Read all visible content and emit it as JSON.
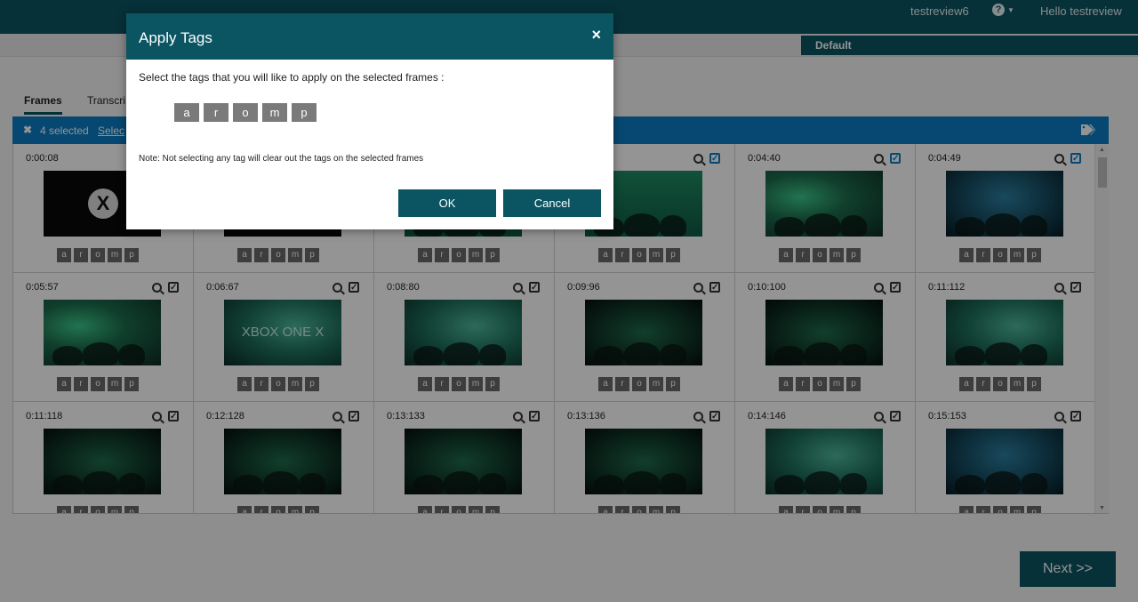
{
  "topbar": {
    "account": "testreview6",
    "help": "?",
    "greeting": "Hello testreview"
  },
  "project_tab": "Default",
  "tabs": [
    "Frames",
    "Transcri"
  ],
  "selection_bar": {
    "count": "4 selected",
    "select_link": "Selec"
  },
  "frame_tags": [
    "a",
    "r",
    "o",
    "m",
    "p"
  ],
  "frames": [
    {
      "time": "0:00:08",
      "thumb": "xbox-logo",
      "checked": false
    },
    {
      "time": "",
      "thumb": "dark",
      "checked": false
    },
    {
      "time": "",
      "thumb": "stage",
      "checked": false
    },
    {
      "time": "",
      "thumb": "stage",
      "checked": true
    },
    {
      "time": "0:04:40",
      "thumb": "crowd",
      "checked": true
    },
    {
      "time": "0:04:49",
      "thumb": "blue",
      "checked": true
    },
    {
      "time": "0:05:57",
      "thumb": "crowd",
      "checked": false
    },
    {
      "time": "0:06:67",
      "thumb": "xbox-one-x",
      "checked": false
    },
    {
      "time": "0:08:80",
      "thumb": "teal",
      "checked": false
    },
    {
      "time": "0:09:96",
      "thumb": "night",
      "checked": false
    },
    {
      "time": "0:10:100",
      "thumb": "night",
      "checked": false
    },
    {
      "time": "0:11:112",
      "thumb": "teal",
      "checked": false
    },
    {
      "time": "0:11:118",
      "thumb": "night",
      "checked": false
    },
    {
      "time": "0:12:128",
      "thumb": "night",
      "checked": false
    },
    {
      "time": "0:13:133",
      "thumb": "night",
      "checked": false
    },
    {
      "time": "0:13:136",
      "thumb": "night",
      "checked": false
    },
    {
      "time": "0:14:146",
      "thumb": "teal",
      "checked": false
    },
    {
      "time": "0:15:153",
      "thumb": "blue",
      "checked": false
    }
  ],
  "thumb_text": {
    "xbox_one_x": "XBOX ONE X",
    "xbox_logo": "X"
  },
  "next_button": "Next >>",
  "modal": {
    "title": "Apply Tags",
    "close": "×",
    "prompt": "Select the tags that you will like to apply on the selected frames :",
    "tags": [
      "a",
      "r",
      "o",
      "m",
      "p"
    ],
    "note": "Note: Not selecting any tag will clear out the tags on the selected frames",
    "ok": "OK",
    "cancel": "Cancel"
  },
  "colors": {
    "header": "#0b5563",
    "selection_bar": "#0b7cc3",
    "tag_bg": "#6a6a6a"
  },
  "icons": [
    "help-icon",
    "close-icon",
    "tag-icon",
    "zoom-icon",
    "check-icon"
  ]
}
